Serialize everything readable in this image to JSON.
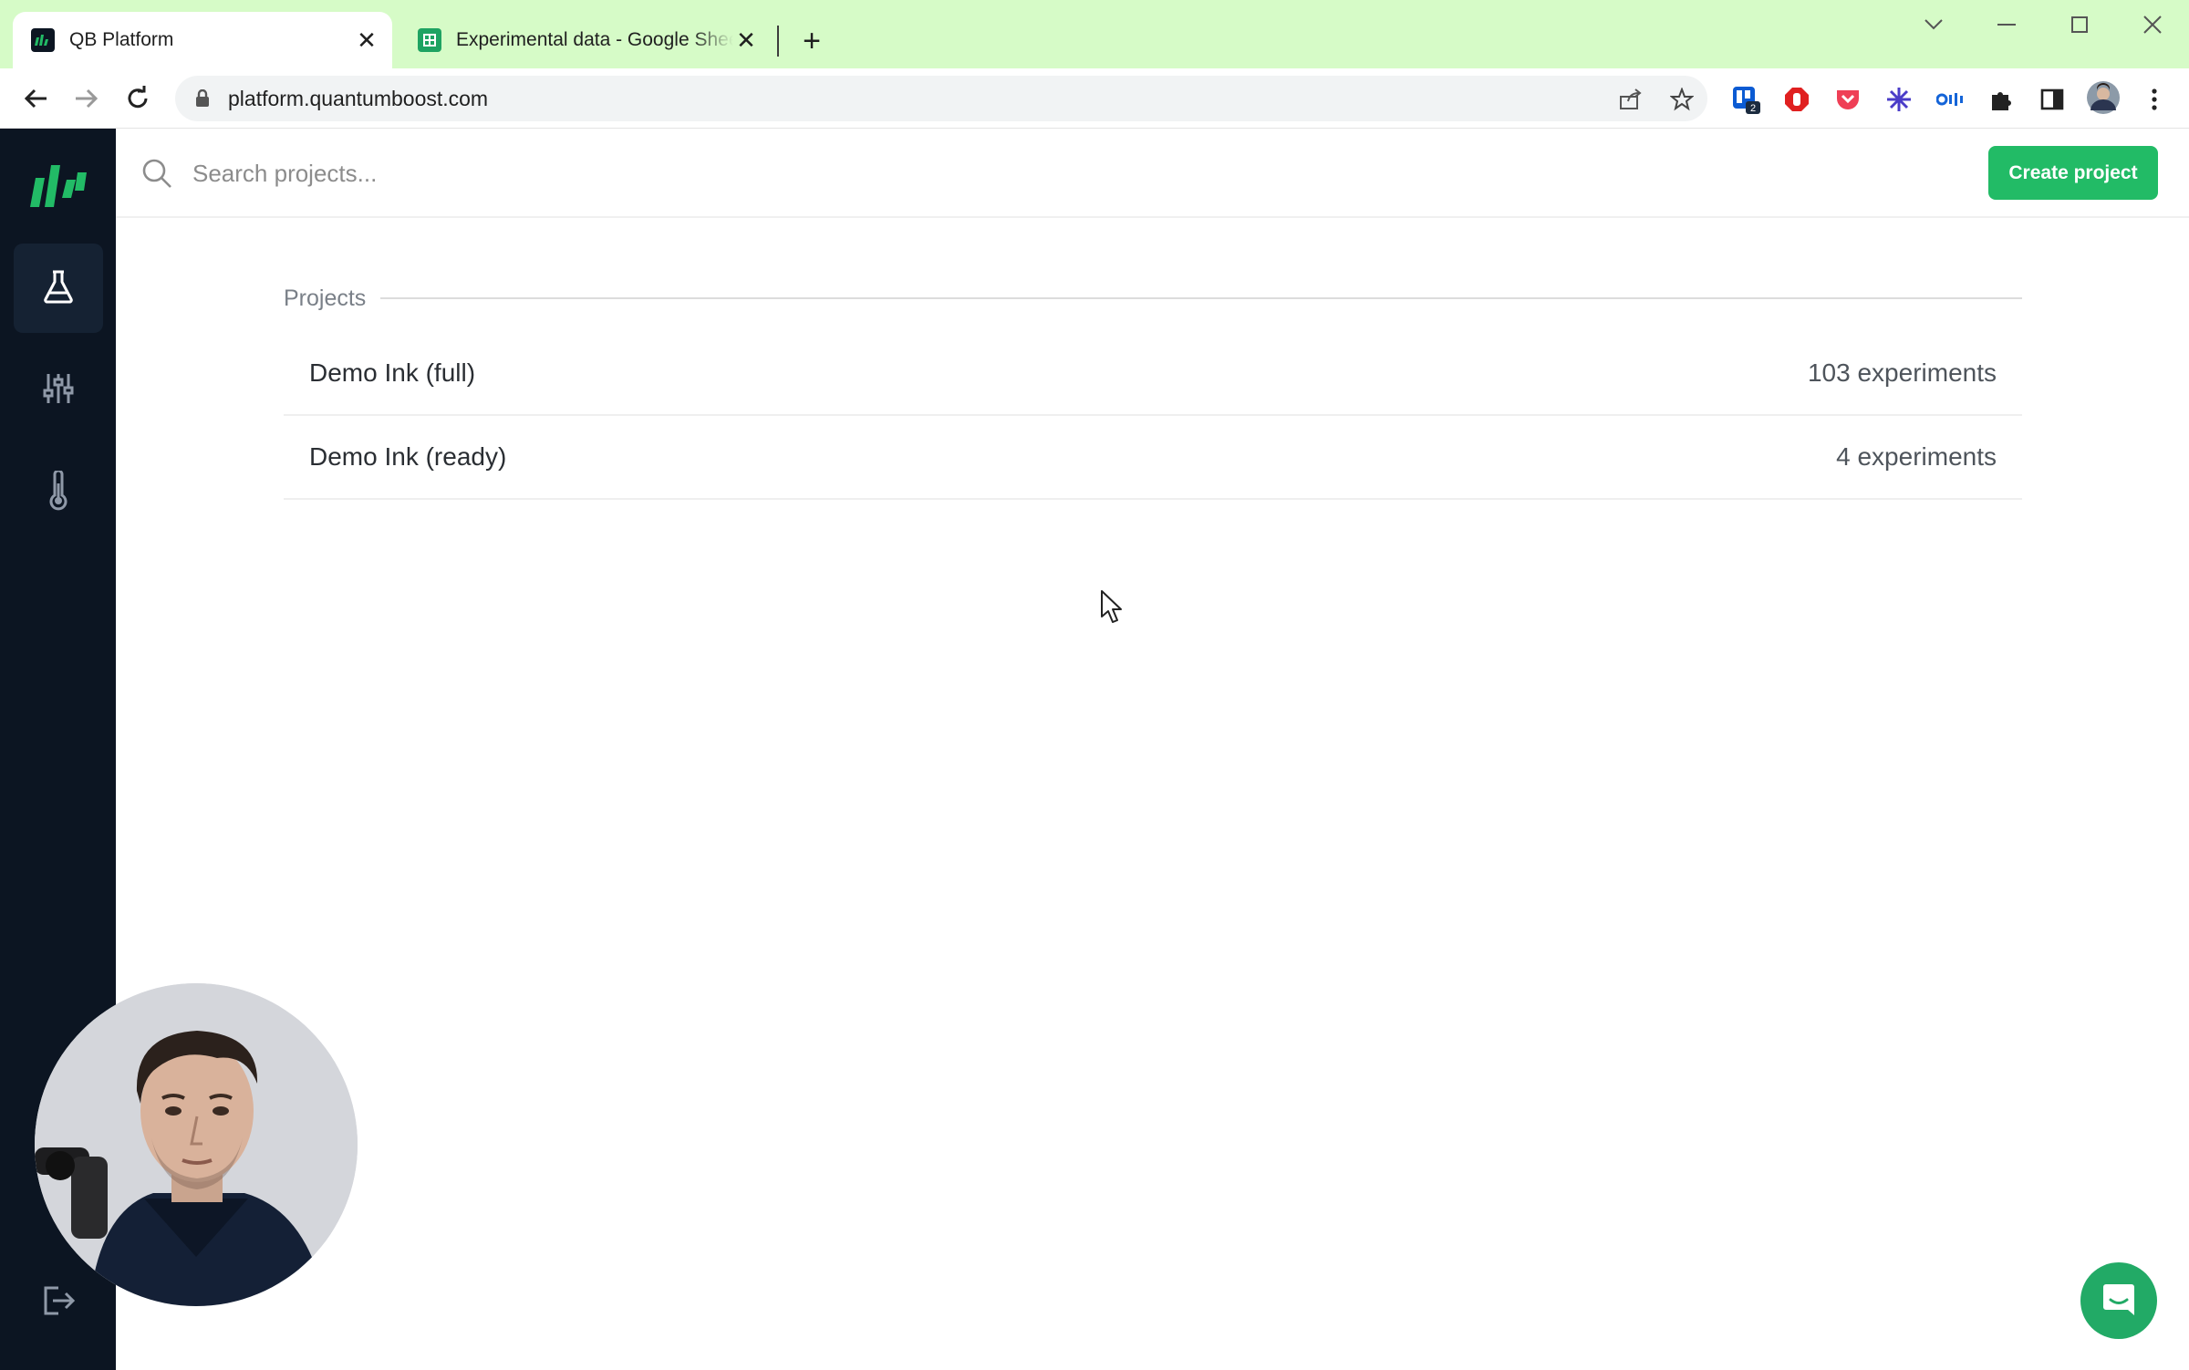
{
  "browser": {
    "tabs": [
      {
        "title": "QB Platform",
        "favicon": "qb-logo-icon",
        "active": true
      },
      {
        "title": "Experimental data - Google Sheets",
        "favicon": "google-sheets-icon",
        "active": false
      }
    ],
    "url": "platform.quantumboost.com",
    "extension_badge": "2"
  },
  "sidebar": {
    "items": [
      {
        "name": "experiments",
        "icon": "flask-icon",
        "active": true
      },
      {
        "name": "optimization",
        "icon": "sliders-icon",
        "active": false
      },
      {
        "name": "measurements",
        "icon": "thermometer-icon",
        "active": false
      }
    ]
  },
  "search": {
    "placeholder": "Search projects..."
  },
  "header": {
    "create_label": "Create project"
  },
  "projects": {
    "section_label": "Projects",
    "items": [
      {
        "name": "Demo Ink (full)",
        "count": "103 experiments"
      },
      {
        "name": "Demo Ink (ready)",
        "count": "4 experiments"
      }
    ]
  },
  "colors": {
    "brand_green": "#22bb66",
    "sidebar_bg": "#0c1522",
    "tabbar_bg": "#d6fbc7"
  }
}
